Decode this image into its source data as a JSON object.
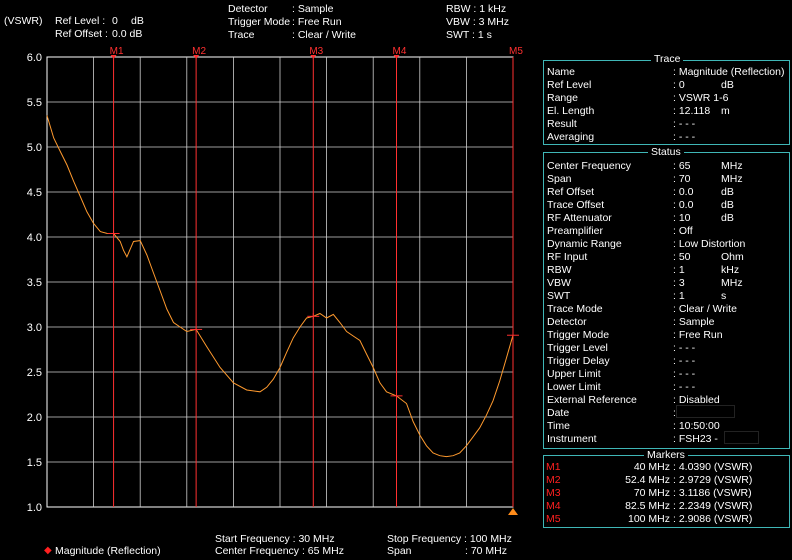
{
  "header": {
    "unit": "(VSWR)",
    "ref_level_label": "Ref Level :",
    "ref_level_value": "0",
    "ref_level_unit": "dB",
    "ref_offset_label": "Ref Offset :",
    "ref_offset_value": "0.0 dB",
    "detector_label": "Detector",
    "detector_value": ": Sample",
    "trigger_label": "Trigger Mode",
    "trigger_value": ": Free Run",
    "trace_label": "Trace",
    "trace_value": ": Clear / Write",
    "rbw": "RBW : 1 kHz",
    "vbw": "VBW : 3 MHz",
    "swt": "SWT : 1 s"
  },
  "footer": {
    "legend": "Magnitude (Reflection)",
    "start_freq": "Start Frequency   : 30 MHz",
    "center_freq": "Center Frequency : 65 MHz",
    "stop_freq": "Stop Frequency : 100 MHz",
    "span_label": "Span",
    "span_value": ":   70 MHz"
  },
  "trace_panel": {
    "title": "Trace",
    "rows": [
      {
        "label": "Name",
        "value": ": Magnitude (Reflection)",
        "unit": ""
      },
      {
        "label": "Ref Level",
        "value": ":     0",
        "unit": "dB"
      },
      {
        "label": "Range",
        "value": ": VSWR 1-6",
        "unit": ""
      },
      {
        "label": "El. Length",
        "value": ": 12.118",
        "unit": "m"
      },
      {
        "label": "Result",
        "value": ": - - -",
        "unit": ""
      },
      {
        "label": "Averaging",
        "value": ": - - -",
        "unit": ""
      }
    ]
  },
  "status_panel": {
    "title": "Status",
    "rows": [
      {
        "label": "Center Frequency",
        "value": ": 65",
        "unit": "MHz"
      },
      {
        "label": "Span",
        "value": ": 70",
        "unit": "MHz"
      },
      {
        "label": "Ref Offset",
        "value": ":   0.0",
        "unit": "dB"
      },
      {
        "label": "Trace Offset",
        "value": ":   0.0",
        "unit": "dB"
      },
      {
        "label": "RF Attenuator",
        "value": ": 10",
        "unit": "dB"
      },
      {
        "label": "Preamplifier",
        "value": ": Off",
        "unit": ""
      },
      {
        "label": "Dynamic Range",
        "value": ": Low Distortion",
        "unit": ""
      },
      {
        "label": "RF Input",
        "value": ": 50",
        "unit": "Ohm"
      },
      {
        "label": "RBW",
        "value": ":     1",
        "unit": "kHz"
      },
      {
        "label": "VBW",
        "value": ":     3",
        "unit": "MHz"
      },
      {
        "label": "SWT",
        "value": ":     1",
        "unit": "s"
      },
      {
        "label": "Trace Mode",
        "value": ": Clear / Write",
        "unit": ""
      },
      {
        "label": "Detector",
        "value": ": Sample",
        "unit": ""
      },
      {
        "label": "Trigger Mode",
        "value": ": Free Run",
        "unit": ""
      },
      {
        "label": "Trigger Level",
        "value": ": - - -",
        "unit": ""
      },
      {
        "label": "Trigger Delay",
        "value": ": - - -",
        "unit": ""
      },
      {
        "label": "Upper Limit",
        "value": ": - - -",
        "unit": ""
      },
      {
        "label": "Lower Limit",
        "value": ": - - -",
        "unit": ""
      },
      {
        "label": "External Reference",
        "value": ": Disabled",
        "unit": ""
      },
      {
        "label": "Date",
        "value": ":",
        "unit": ""
      },
      {
        "label": "Time",
        "value": ": 10:50:00",
        "unit": ""
      },
      {
        "label": "Instrument",
        "value": ": FSH23 -",
        "unit": ""
      }
    ]
  },
  "markers_panel": {
    "title": "Markers",
    "rows": [
      {
        "label": "M1",
        "freq": "40 MHz",
        "value": ": 4.0390 (VSWR)"
      },
      {
        "label": "M2",
        "freq": "52.4 MHz",
        "value": ": 2.9729 (VSWR)"
      },
      {
        "label": "M3",
        "freq": "70 MHz",
        "value": ": 3.1186 (VSWR)"
      },
      {
        "label": "M4",
        "freq": "82.5 MHz",
        "value": ": 2.2349 (VSWR)"
      },
      {
        "label": "M5",
        "freq": "100 MHz",
        "value": ": 2.9086 (VSWR)"
      }
    ]
  },
  "colors": {
    "trace": "#ff9a2e",
    "marker": "#ff3030",
    "grid": "#ffffff",
    "panel_border": "#3fb6b6"
  },
  "chart_data": {
    "type": "line",
    "ylabel": "(VSWR)",
    "ylim": [
      1.0,
      6.0
    ],
    "xlim": [
      30,
      100
    ],
    "yticks": [
      "6.0",
      "5.5",
      "5.0",
      "4.5",
      "4.0",
      "3.5",
      "3.0",
      "2.5",
      "2.0",
      "1.5",
      "1.0"
    ],
    "markers": [
      {
        "name": "M1",
        "x": 40,
        "y": 4.039
      },
      {
        "name": "M2",
        "x": 52.4,
        "y": 2.9729
      },
      {
        "name": "M3",
        "x": 70,
        "y": 3.1186
      },
      {
        "name": "M4",
        "x": 82.5,
        "y": 2.2349
      },
      {
        "name": "M5",
        "x": 100,
        "y": 2.9086
      }
    ],
    "series": [
      {
        "name": "Magnitude (Reflection)",
        "x": [
          30,
          31,
          32,
          33,
          34,
          35,
          36,
          37,
          38,
          39,
          40,
          41,
          41.5,
          42,
          43,
          44,
          45,
          46,
          47,
          48,
          49,
          50,
          51,
          52.4,
          54,
          56,
          58,
          60,
          62,
          63,
          64,
          65,
          66,
          67,
          68,
          69,
          70,
          71,
          72,
          73,
          74,
          75,
          76,
          77,
          78,
          79,
          80,
          81,
          82.5,
          84,
          85,
          86,
          87,
          88,
          89,
          90,
          91,
          92,
          93,
          94,
          95,
          96,
          97,
          98,
          99,
          100
        ],
        "y": [
          5.35,
          5.1,
          4.95,
          4.8,
          4.62,
          4.45,
          4.28,
          4.15,
          4.06,
          4.04,
          4.039,
          3.95,
          3.85,
          3.78,
          3.95,
          3.96,
          3.8,
          3.6,
          3.4,
          3.2,
          3.05,
          3.0,
          2.95,
          2.9729,
          2.78,
          2.55,
          2.38,
          2.3,
          2.28,
          2.33,
          2.42,
          2.55,
          2.72,
          2.88,
          3.0,
          3.1,
          3.1186,
          3.15,
          3.1,
          3.14,
          3.05,
          2.95,
          2.9,
          2.85,
          2.7,
          2.55,
          2.38,
          2.28,
          2.2349,
          2.15,
          1.95,
          1.8,
          1.68,
          1.6,
          1.57,
          1.56,
          1.57,
          1.6,
          1.68,
          1.78,
          1.88,
          2.02,
          2.18,
          2.4,
          2.65,
          2.9086
        ]
      }
    ]
  }
}
